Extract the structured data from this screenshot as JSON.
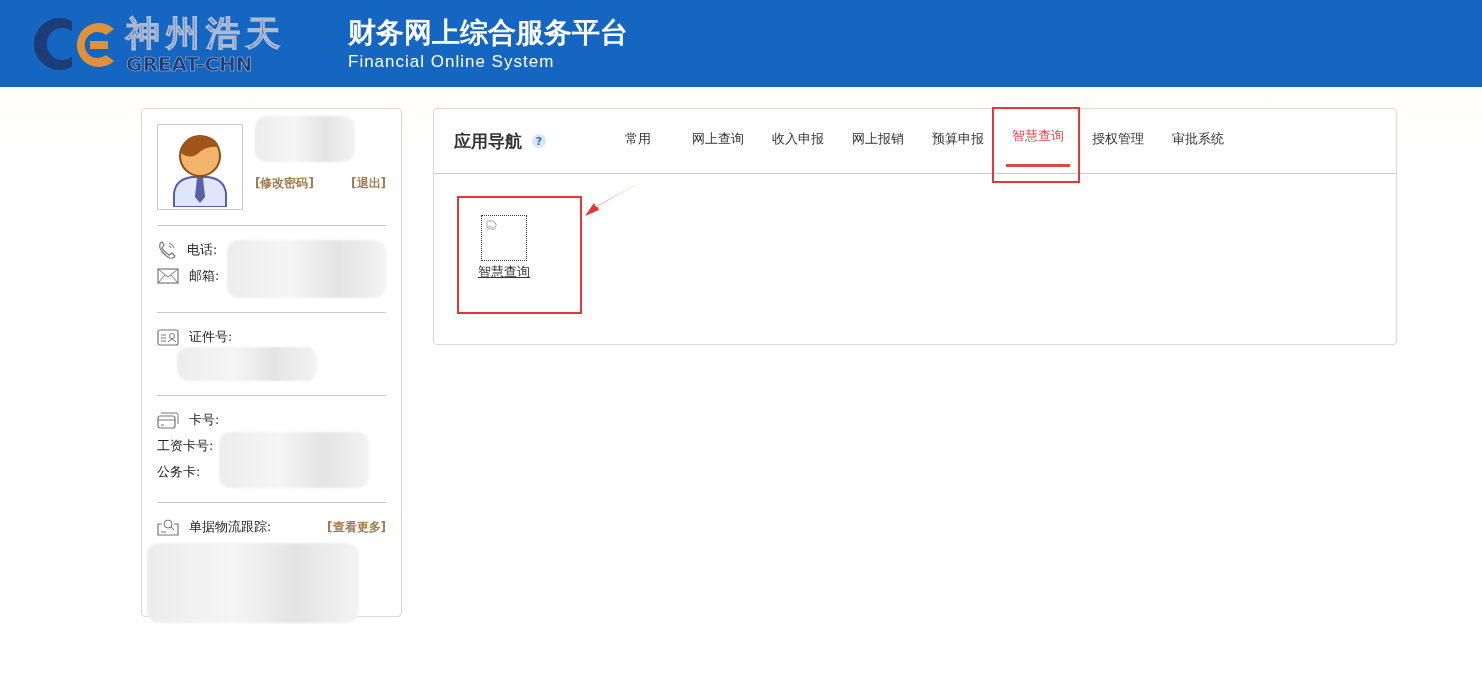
{
  "header": {
    "logo_cn": "神州浩天",
    "logo_en": "GREAT-CHN",
    "title": "财务网上综合服务平台",
    "subtitle": "Financial Online System"
  },
  "profile": {
    "links": [
      "[修改密码]",
      "[退出]"
    ],
    "contact": [
      {
        "kind": "phone",
        "label": "电话:"
      },
      {
        "kind": "mail",
        "label": "邮箱:"
      }
    ],
    "id_label": "证件号:",
    "cards": {
      "label": "卡号:",
      "rows": [
        "工资卡号:",
        "公务卡:"
      ]
    },
    "tracking": {
      "label": "单据物流跟踪:",
      "more": "[查看更多]"
    }
  },
  "nav": {
    "title": "应用导航",
    "help": "?",
    "tabs": [
      {
        "label": "常用",
        "selected": false
      },
      {
        "label": "网上查询",
        "selected": false
      },
      {
        "label": "收入申报",
        "selected": false
      },
      {
        "label": "网上报销",
        "selected": false
      },
      {
        "label": "预算申报",
        "selected": false
      },
      {
        "label": "智慧查询",
        "selected": true
      },
      {
        "label": "授权管理",
        "selected": false
      },
      {
        "label": "审批系统",
        "selected": false
      }
    ],
    "apps": [
      {
        "label": "智慧查询"
      }
    ]
  }
}
